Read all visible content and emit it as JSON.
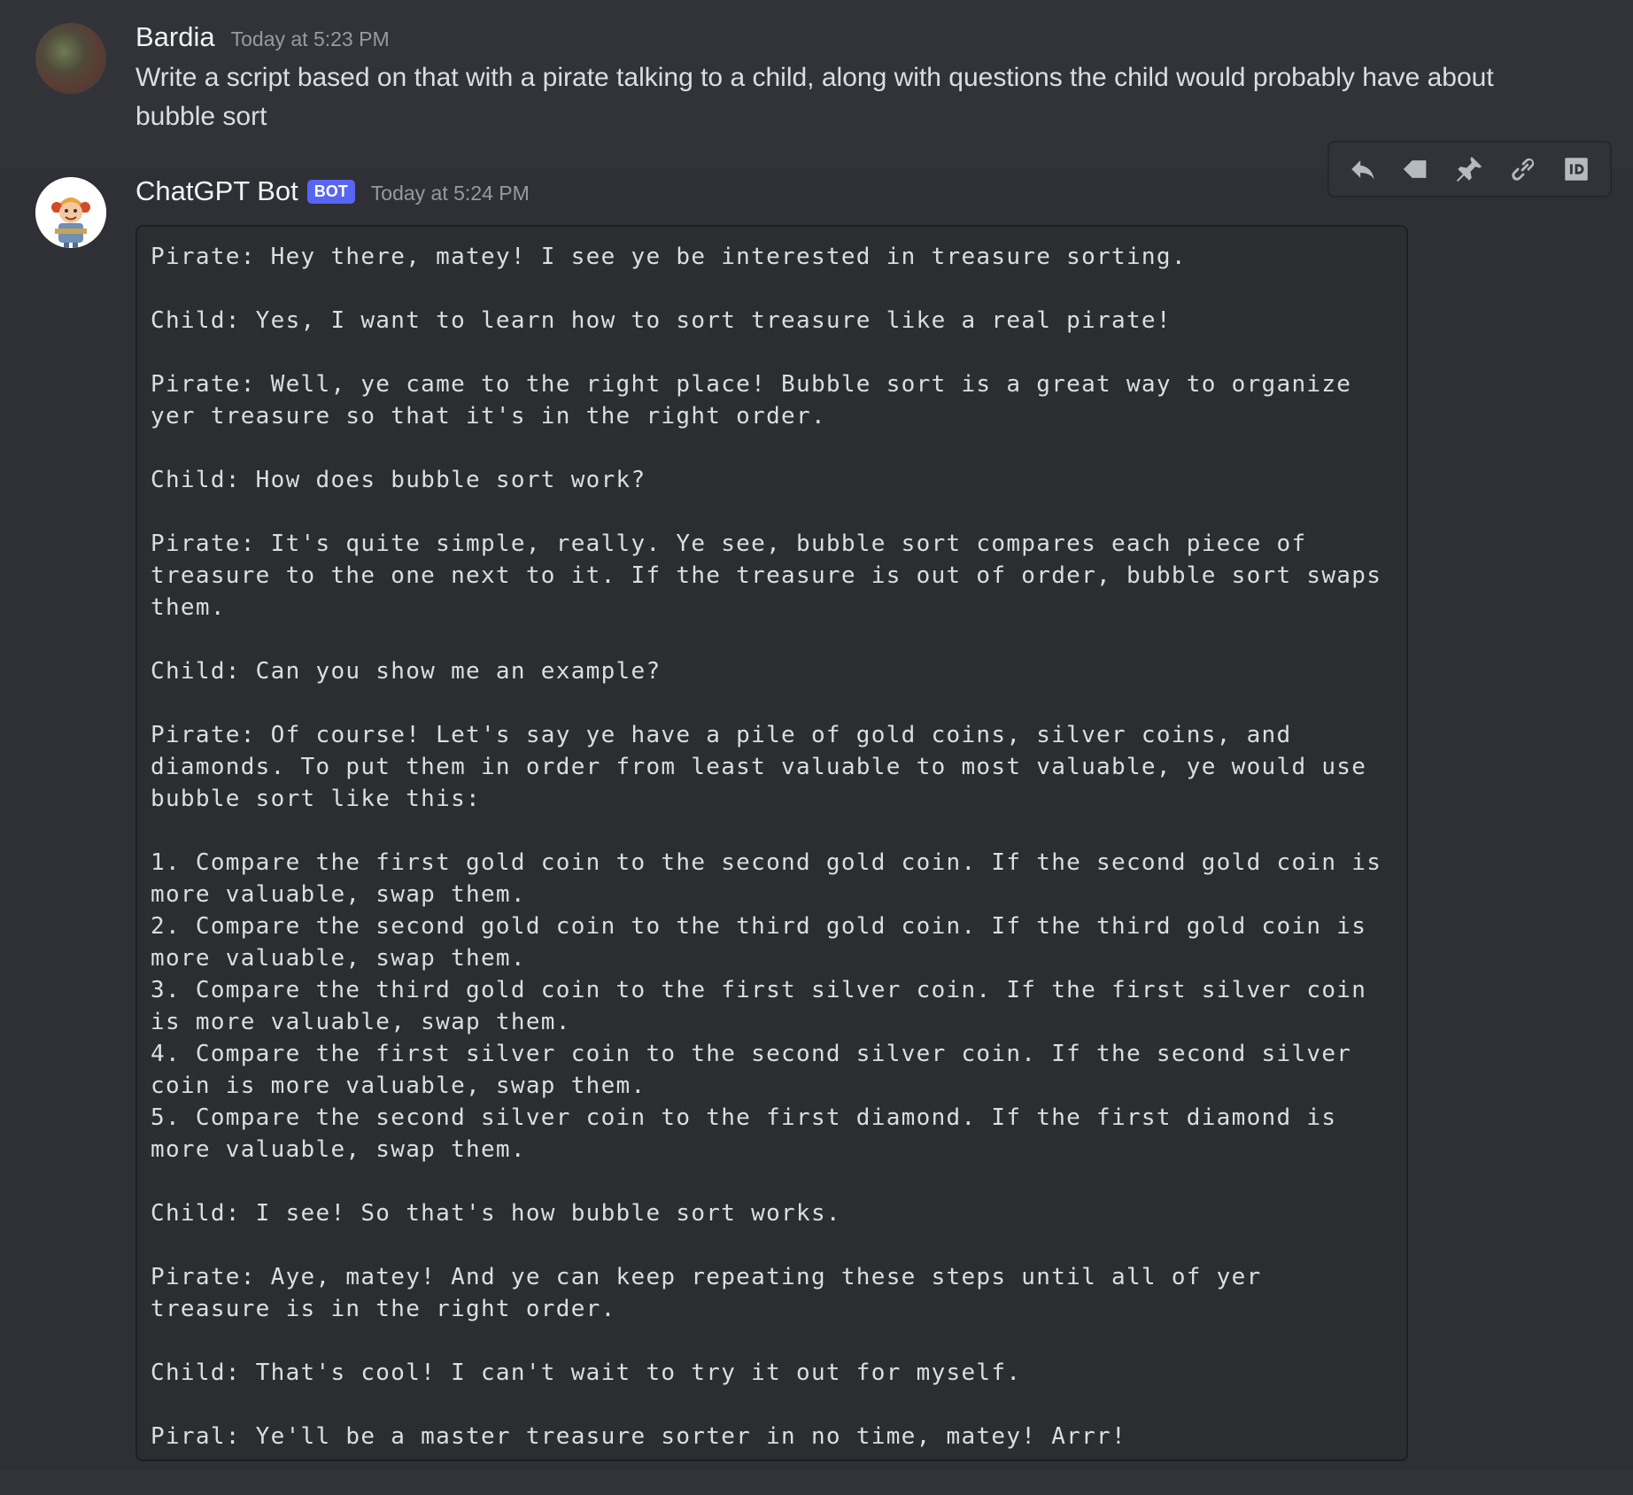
{
  "messages": [
    {
      "author": "Bardia",
      "timestamp": "Today at 5:23 PM",
      "content": "Write a script based on that with a pirate talking to a child, along with questions the child would probably have about bubble sort"
    },
    {
      "author": "ChatGPT Bot",
      "badge": "BOT",
      "timestamp": "Today at 5:24 PM",
      "content": "Pirate: Hey there, matey! I see ye be interested in treasure sorting.\n\nChild: Yes, I want to learn how to sort treasure like a real pirate!\n\nPirate: Well, ye came to the right place! Bubble sort is a great way to organize yer treasure so that it's in the right order.\n\nChild: How does bubble sort work?\n\nPirate: It's quite simple, really. Ye see, bubble sort compares each piece of treasure to the one next to it. If the treasure is out of order, bubble sort swaps them.\n\nChild: Can you show me an example?\n\nPirate: Of course! Let's say ye have a pile of gold coins, silver coins, and diamonds. To put them in order from least valuable to most valuable, ye would use bubble sort like this:\n\n1. Compare the first gold coin to the second gold coin. If the second gold coin is more valuable, swap them.\n2. Compare the second gold coin to the third gold coin. If the third gold coin is more valuable, swap them.\n3. Compare the third gold coin to the first silver coin. If the first silver coin is more valuable, swap them.\n4. Compare the first silver coin to the second silver coin. If the second silver coin is more valuable, swap them.\n5. Compare the second silver coin to the first diamond. If the first diamond is more valuable, swap them.\n\nChild: I see! So that's how bubble sort works.\n\nPirate: Aye, matey! And ye can keep repeating these steps until all of yer treasure is in the right order.\n\nChild: That's cool! I can't wait to try it out for myself.\n\nPiral: Ye'll be a master treasure sorter in no time, matey! Arrr!"
    }
  ],
  "toolbar": {
    "icons": [
      "reply-icon",
      "tag-icon",
      "pin-icon",
      "link-icon",
      "id-icon"
    ]
  },
  "colors": {
    "background": "#313338",
    "hover_background": "#2e3035",
    "code_background": "#2b2d31",
    "bot_badge": "#5865f2",
    "username": "#f2f3f5",
    "timestamp": "#949ba4",
    "text": "#dbdee1",
    "icon": "#b5bac1"
  }
}
